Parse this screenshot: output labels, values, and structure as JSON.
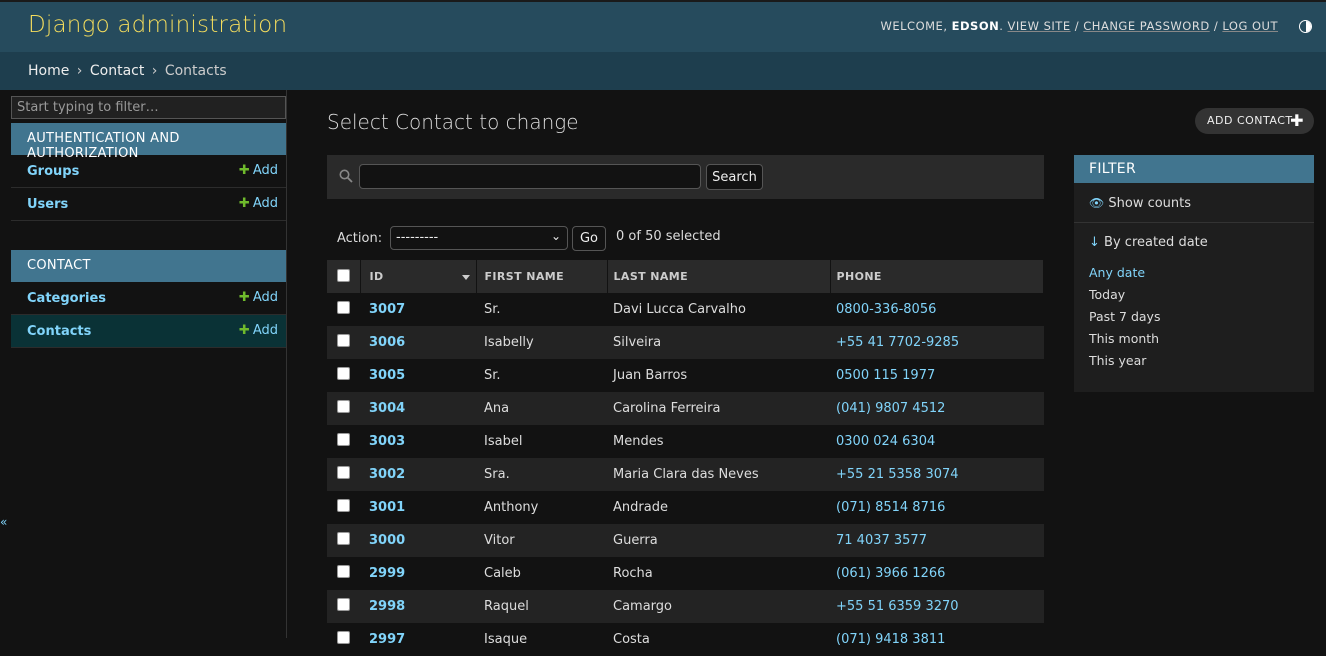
{
  "header": {
    "branding": "Django administration",
    "welcome": "WELCOME,",
    "username": "EDSON",
    "view_site": "VIEW SITE",
    "change_password": "CHANGE PASSWORD",
    "log_out": "LOG OUT",
    "separator": "/"
  },
  "breadcrumbs": {
    "home": "Home",
    "app": "Contact",
    "current": "Contacts",
    "sep": "›"
  },
  "sidebar": {
    "filter_placeholder": "Start typing to filter…",
    "modules": [
      {
        "caption": "AUTHENTICATION AND AUTHORIZATION",
        "models": [
          {
            "name": "Groups",
            "add": "Add"
          },
          {
            "name": "Users",
            "add": "Add"
          }
        ]
      },
      {
        "caption": "CONTACT",
        "models": [
          {
            "name": "Categories",
            "add": "Add"
          },
          {
            "name": "Contacts",
            "add": "Add"
          }
        ]
      }
    ],
    "collapse": "«"
  },
  "main": {
    "title": "Select Contact to change",
    "add_button": "ADD CONTACT",
    "search_button": "Search",
    "action_label": "Action:",
    "action_value": "---------",
    "go_button": "Go",
    "selected_count": "0 of 50 selected"
  },
  "table": {
    "headers": {
      "id": "ID",
      "first_name": "FIRST NAME",
      "last_name": "LAST NAME",
      "phone": "PHONE"
    },
    "rows": [
      {
        "id": "3007",
        "first": "Sr.",
        "last": "Davi Lucca Carvalho",
        "phone": "0800-336-8056"
      },
      {
        "id": "3006",
        "first": "Isabelly",
        "last": "Silveira",
        "phone": "+55 41 7702-9285"
      },
      {
        "id": "3005",
        "first": "Sr.",
        "last": "Juan Barros",
        "phone": "0500 115 1977"
      },
      {
        "id": "3004",
        "first": "Ana",
        "last": "Carolina Ferreira",
        "phone": "(041) 9807 4512"
      },
      {
        "id": "3003",
        "first": "Isabel",
        "last": "Mendes",
        "phone": "0300 024 6304"
      },
      {
        "id": "3002",
        "first": "Sra.",
        "last": "Maria Clara das Neves",
        "phone": "+55 21 5358 3074"
      },
      {
        "id": "3001",
        "first": "Anthony",
        "last": "Andrade",
        "phone": "(071) 8514 8716"
      },
      {
        "id": "3000",
        "first": "Vitor",
        "last": "Guerra",
        "phone": "71 4037 3577"
      },
      {
        "id": "2999",
        "first": "Caleb",
        "last": "Rocha",
        "phone": "(061) 3966 1266"
      },
      {
        "id": "2998",
        "first": "Raquel",
        "last": "Camargo",
        "phone": "+55 51 6359 3270"
      },
      {
        "id": "2997",
        "first": "Isaque",
        "last": "Costa",
        "phone": "(071) 9418 3811"
      }
    ]
  },
  "filter": {
    "title": "FILTER",
    "show_counts": "Show counts",
    "by_created": "By created date",
    "choices": [
      "Any date",
      "Today",
      "Past 7 days",
      "This month",
      "This year"
    ]
  }
}
